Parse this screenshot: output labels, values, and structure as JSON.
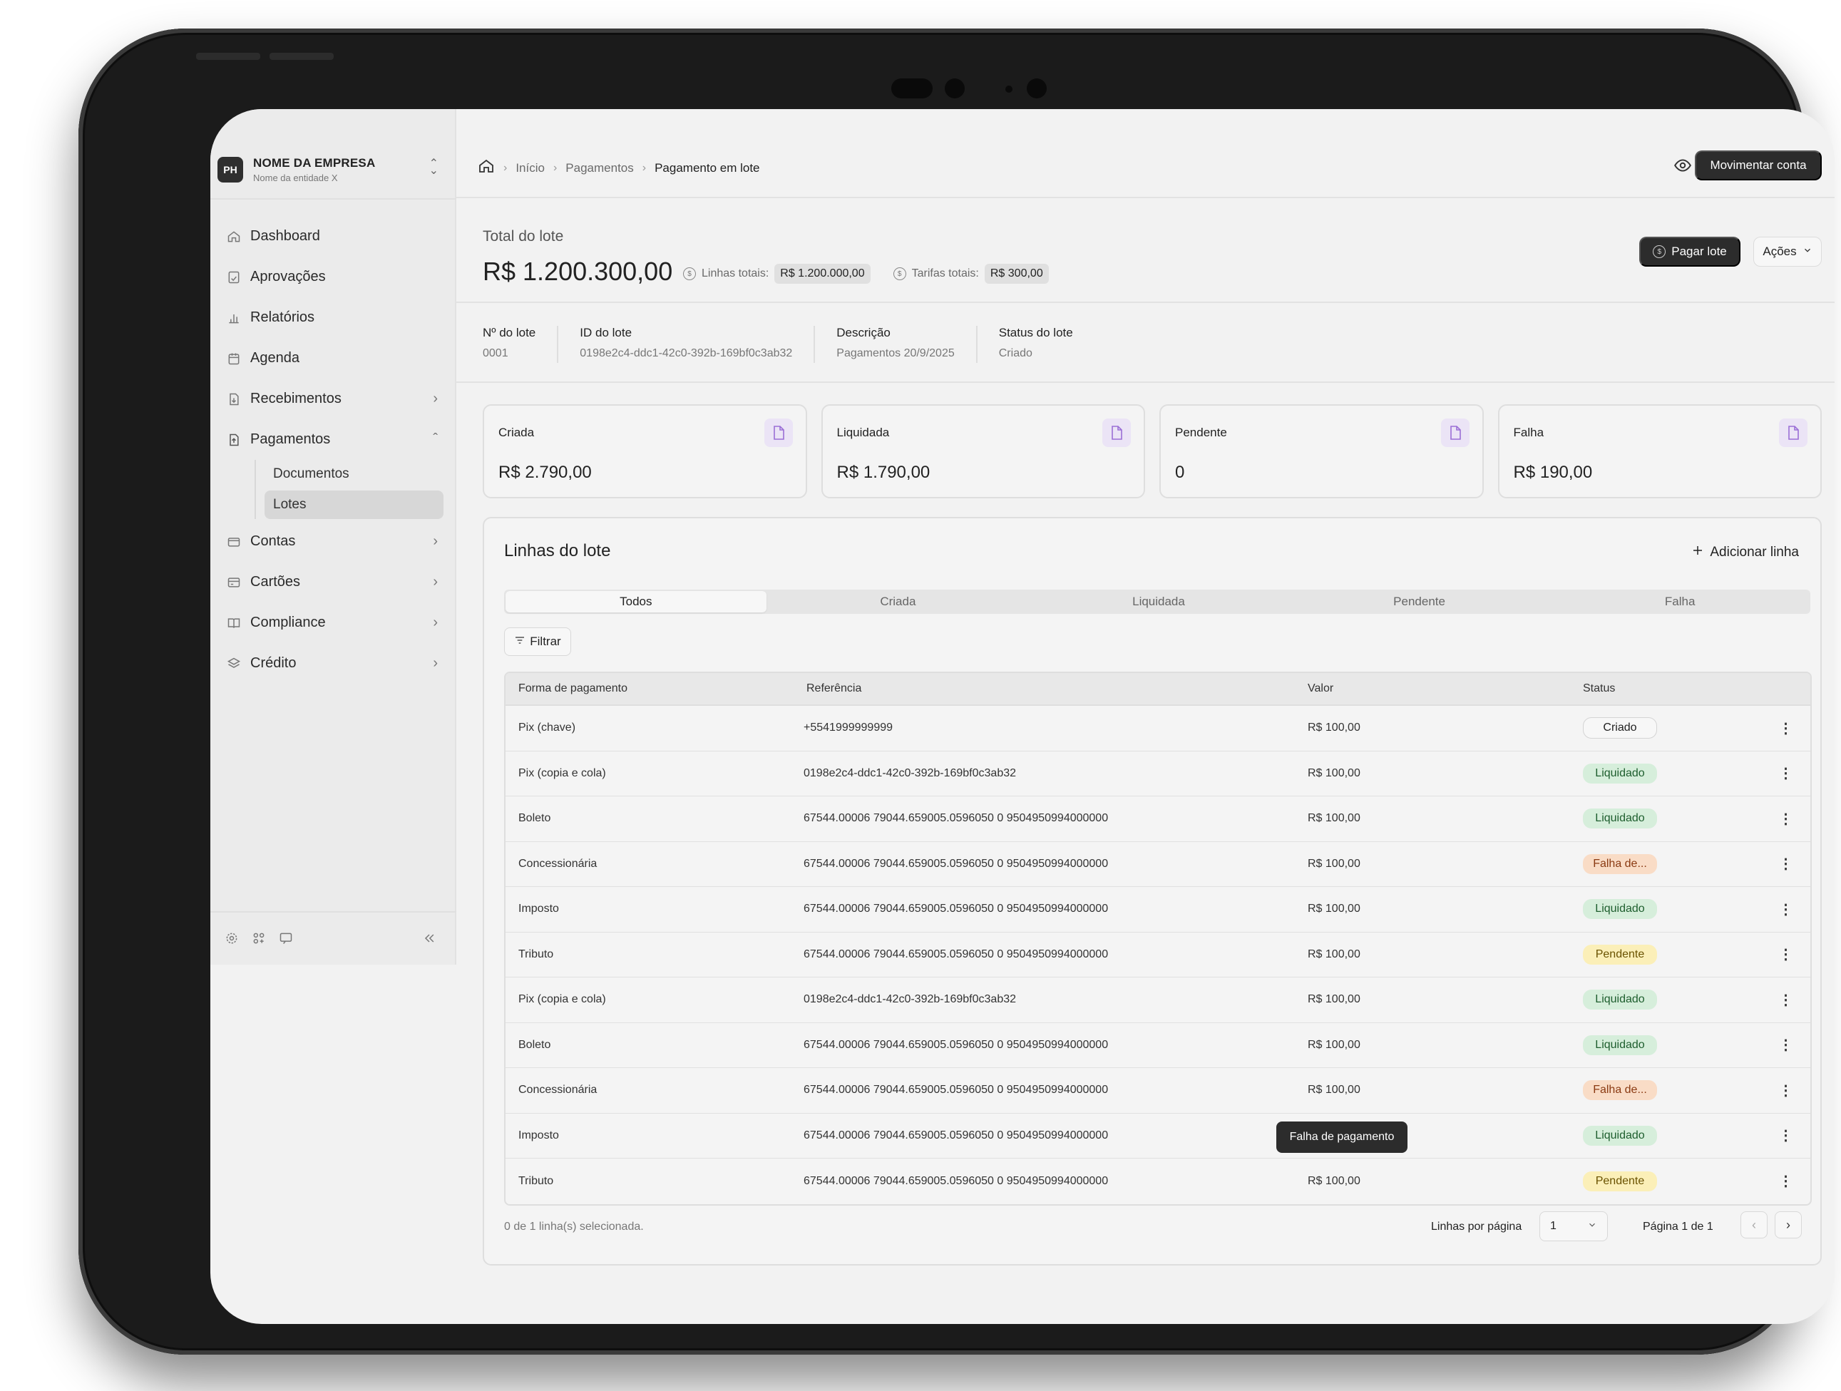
{
  "company": {
    "logo": "PH",
    "name": "NOME DA EMPRESA",
    "entity": "Nome da entidade X"
  },
  "sidebar": {
    "items": [
      {
        "label": "Dashboard",
        "icon": "home-icon"
      },
      {
        "label": "Aprovações",
        "icon": "approval-icon"
      },
      {
        "label": "Relatórios",
        "icon": "bar-chart-icon"
      },
      {
        "label": "Agenda",
        "icon": "calendar-icon"
      },
      {
        "label": "Recebimentos",
        "icon": "receipt-icon"
      },
      {
        "label": "Pagamentos",
        "icon": "payment-file-icon"
      },
      {
        "label": "Contas",
        "icon": "wallet-icon"
      },
      {
        "label": "Cartões",
        "icon": "card-icon"
      },
      {
        "label": "Compliance",
        "icon": "book-icon"
      },
      {
        "label": "Crédito",
        "icon": "layers-icon"
      }
    ],
    "sub_items": [
      "Documentos",
      "Lotes"
    ]
  },
  "breadcrumb": {
    "home_icon": "home-icon",
    "items": [
      "Início",
      "Pagamentos",
      "Pagamento em lote"
    ]
  },
  "header": {
    "move_button": "Movimentar conta",
    "eye_icon": "eye-icon"
  },
  "total": {
    "label": "Total do lote",
    "amount": "R$ 1.200.300,00",
    "lines_label": "Linhas totais:",
    "lines_value": "R$ 1.200.000,00",
    "fees_label": "Tarifas totais:",
    "fees_value": "R$ 300,00",
    "pay_button": "Pagar lote",
    "actions_button": "Ações"
  },
  "batch_info": [
    {
      "key": "Nº do lote",
      "value": "0001"
    },
    {
      "key": "ID do lote",
      "value": "0198e2c4-ddc1-42c0-392b-169bf0c3ab32"
    },
    {
      "key": "Descrição",
      "value": "Pagamentos 20/9/2025"
    },
    {
      "key": "Status do lote",
      "value": "Criado"
    }
  ],
  "cards": [
    {
      "label": "Criada",
      "value": "R$ 2.790,00"
    },
    {
      "label": "Liquidada",
      "value": "R$ 1.790,00"
    },
    {
      "label": "Pendente",
      "value": "0"
    },
    {
      "label": "Falha",
      "value": "R$ 190,00"
    }
  ],
  "accent_color": "#9b6fd6",
  "lines": {
    "title": "Linhas do lote",
    "add_button": "Adicionar linha",
    "tabs": [
      "Todos",
      "Criada",
      "Liquidada",
      "Pendente",
      "Falha"
    ],
    "filter_button": "Filtrar",
    "columns": [
      "Forma de pagamento",
      "Referência",
      "Valor",
      "Status"
    ],
    "rows": [
      {
        "method": "Pix (chave)",
        "reference": "+5541999999999",
        "value": "R$ 100,00",
        "status": "Criado",
        "kind": "criado"
      },
      {
        "method": "Pix (copia e cola)",
        "reference": "0198e2c4-ddc1-42c0-392b-169bf0c3ab32",
        "value": "R$ 100,00",
        "status": "Liquidado",
        "kind": "liq"
      },
      {
        "method": "Boleto",
        "reference": "67544.00006 79044.659005.0596050 0 9504950994000000",
        "value": "R$ 100,00",
        "status": "Liquidado",
        "kind": "liq"
      },
      {
        "method": "Concessionária",
        "reference": "67544.00006 79044.659005.0596050 0 9504950994000000",
        "value": "R$ 100,00",
        "status": "Falha de...",
        "kind": "fail"
      },
      {
        "method": "Imposto",
        "reference": "67544.00006 79044.659005.0596050 0 9504950994000000",
        "value": "R$ 100,00",
        "status": "Liquidado",
        "kind": "liq"
      },
      {
        "method": "Tributo",
        "reference": "67544.00006 79044.659005.0596050 0 9504950994000000",
        "value": "R$ 100,00",
        "status": "Pendente",
        "kind": "pend"
      },
      {
        "method": "Pix (copia e cola)",
        "reference": "0198e2c4-ddc1-42c0-392b-169bf0c3ab32",
        "value": "R$ 100,00",
        "status": "Liquidado",
        "kind": "liq"
      },
      {
        "method": "Boleto",
        "reference": "67544.00006 79044.659005.0596050 0 9504950994000000",
        "value": "R$ 100,00",
        "status": "Liquidado",
        "kind": "liq"
      },
      {
        "method": "Concessionária",
        "reference": "67544.00006 79044.659005.0596050 0 9504950994000000",
        "value": "R$ 100,00",
        "status": "Falha de...",
        "kind": "fail"
      },
      {
        "method": "Imposto",
        "reference": "67544.00006 79044.659005.0596050 0 9504950994000000",
        "value": "R$ 100,00",
        "status": "Liquidado",
        "kind": "liq"
      },
      {
        "method": "Tributo",
        "reference": "67544.00006 79044.659005.0596050 0 9504950994000000",
        "value": "R$ 100,00",
        "status": "Pendente",
        "kind": "pend"
      }
    ],
    "tooltip": "Falha de pagamento",
    "selection_text": "0 de 1 linha(s) selecionada.",
    "rows_per_page_label": "Linhas por página",
    "rows_per_page_value": "1",
    "page_info": "Página 1 de 1"
  }
}
